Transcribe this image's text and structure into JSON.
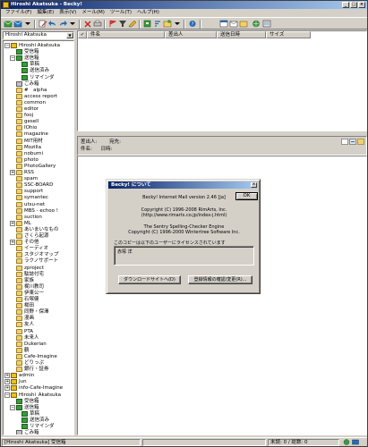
{
  "window": {
    "title": "Hiroshi Akatsuka - Becky!",
    "menu": [
      "ファイル(F)",
      "編集(E)",
      "表示(V)",
      "メール(M)",
      "ツール(T)",
      "ヘルプ(H)"
    ]
  },
  "folder_selector": {
    "value": "Hiroshi Akatsuka"
  },
  "tree": {
    "items": [
      {
        "label": "Hiroshi Akatsuka",
        "level": 0,
        "icon": "account",
        "expander": "−"
      },
      {
        "label": "受信箱",
        "level": 1,
        "icon": "mailbox",
        "expander": ""
      },
      {
        "label": "送信箱",
        "level": 1,
        "icon": "mailbox",
        "expander": "−"
      },
      {
        "label": "草稿",
        "level": 2,
        "icon": "mailbox",
        "expander": ""
      },
      {
        "label": "送信済み",
        "level": 2,
        "icon": "mailbox",
        "expander": ""
      },
      {
        "label": "リマインダ",
        "level": 2,
        "icon": "mailbox",
        "expander": ""
      },
      {
        "label": "ごみ箱",
        "level": 1,
        "icon": "trash",
        "expander": ""
      },
      {
        "label": "#　alpha",
        "level": 1,
        "icon": "folder",
        "expander": ""
      },
      {
        "label": "access report",
        "level": 1,
        "icon": "folder",
        "expander": ""
      },
      {
        "label": "common",
        "level": 1,
        "icon": "folder",
        "expander": ""
      },
      {
        "label": "editor",
        "level": 1,
        "icon": "folder",
        "expander": ""
      },
      {
        "label": "fooj",
        "level": 1,
        "icon": "folder",
        "expander": ""
      },
      {
        "label": "gesell",
        "level": 1,
        "icon": "folder",
        "expander": ""
      },
      {
        "label": "IOhio",
        "level": 1,
        "icon": "folder",
        "expander": ""
      },
      {
        "label": "magazine",
        "level": 1,
        "icon": "folder",
        "expander": ""
      },
      {
        "label": "MIT用材",
        "level": 1,
        "icon": "folder",
        "expander": ""
      },
      {
        "label": "Mozilla",
        "level": 1,
        "icon": "folder",
        "expander": ""
      },
      {
        "label": "noburni",
        "level": 1,
        "icon": "folder",
        "expander": ""
      },
      {
        "label": "photo",
        "level": 1,
        "icon": "folder",
        "expander": ""
      },
      {
        "label": "PhotoGallery",
        "level": 1,
        "icon": "folder",
        "expander": ""
      },
      {
        "label": "RSS",
        "level": 1,
        "icon": "folder",
        "expander": "+"
      },
      {
        "label": "spam",
        "level": 1,
        "icon": "folder",
        "expander": ""
      },
      {
        "label": "SSC-BOARD",
        "level": 1,
        "icon": "folder",
        "expander": ""
      },
      {
        "label": "support",
        "level": 1,
        "icon": "folder",
        "expander": ""
      },
      {
        "label": "symantec",
        "level": 1,
        "icon": "folder",
        "expander": ""
      },
      {
        "label": "utsu-net",
        "level": 1,
        "icon": "folder",
        "expander": ""
      },
      {
        "label": "MBS - echoo !",
        "level": 1,
        "icon": "folder",
        "expander": ""
      },
      {
        "label": "suction",
        "level": 1,
        "icon": "folder",
        "expander": ""
      },
      {
        "label": "ML",
        "level": 1,
        "icon": "folder",
        "expander": "+"
      },
      {
        "label": "あいまいなもの",
        "level": 1,
        "icon": "folder",
        "expander": ""
      },
      {
        "label": "さくら起源",
        "level": 1,
        "icon": "folder",
        "expander": ""
      },
      {
        "label": "その他",
        "level": 1,
        "icon": "folder",
        "expander": "+"
      },
      {
        "label": "イーディオ",
        "level": 1,
        "icon": "folder",
        "expander": ""
      },
      {
        "label": "スタジオマップ",
        "level": 1,
        "icon": "folder",
        "expander": ""
      },
      {
        "label": "ラクノサポート",
        "level": 1,
        "icon": "folder",
        "expander": ""
      },
      {
        "label": "zproject",
        "level": 1,
        "icon": "folder",
        "expander": ""
      },
      {
        "label": "駄誌付宅",
        "level": 1,
        "icon": "folder",
        "expander": ""
      },
      {
        "label": "家族",
        "level": 1,
        "icon": "folder",
        "expander": ""
      },
      {
        "label": "梶川教司",
        "level": 1,
        "icon": "folder",
        "expander": ""
      },
      {
        "label": "伊東公一",
        "level": 1,
        "icon": "folder",
        "expander": ""
      },
      {
        "label": "石塚健",
        "level": 1,
        "icon": "folder",
        "expander": ""
      },
      {
        "label": "楊田",
        "level": 1,
        "icon": "folder",
        "expander": ""
      },
      {
        "label": "同野・保澤",
        "level": 1,
        "icon": "folder",
        "expander": ""
      },
      {
        "label": "漫画",
        "level": 1,
        "icon": "folder",
        "expander": ""
      },
      {
        "label": "友人",
        "level": 1,
        "icon": "folder",
        "expander": ""
      },
      {
        "label": "PTA",
        "level": 1,
        "icon": "folder",
        "expander": ""
      },
      {
        "label": "未来人",
        "level": 1,
        "icon": "folder",
        "expander": ""
      },
      {
        "label": "Dukerian",
        "level": 1,
        "icon": "folder",
        "expander": ""
      },
      {
        "label": "鶴",
        "level": 1,
        "icon": "folder",
        "expander": ""
      },
      {
        "label": "Cafe-Imagine",
        "level": 1,
        "icon": "folder",
        "expander": ""
      },
      {
        "label": "どりっぷ",
        "level": 1,
        "icon": "folder",
        "expander": ""
      },
      {
        "label": "銀行・証券",
        "level": 1,
        "icon": "folder",
        "expander": ""
      },
      {
        "label": "admin",
        "level": 0,
        "icon": "account",
        "expander": "+"
      },
      {
        "label": "Jun",
        "level": 0,
        "icon": "account",
        "expander": "+"
      },
      {
        "label": "info-Cafe-Imagine",
        "level": 0,
        "icon": "account",
        "expander": "+"
      },
      {
        "label": "Hiroshi_Akatsuka",
        "level": 0,
        "icon": "account",
        "expander": "−"
      },
      {
        "label": "受信箱",
        "level": 1,
        "icon": "mailbox",
        "expander": ""
      },
      {
        "label": "送信箱",
        "level": 1,
        "icon": "mailbox",
        "expander": "−"
      },
      {
        "label": "草稿",
        "level": 2,
        "icon": "mailbox",
        "expander": ""
      },
      {
        "label": "送信済み",
        "level": 2,
        "icon": "mailbox",
        "expander": ""
      },
      {
        "label": "リマインダ",
        "level": 2,
        "icon": "mailbox",
        "expander": ""
      },
      {
        "label": "ごみ箱",
        "level": 1,
        "icon": "trash",
        "expander": ""
      }
    ]
  },
  "list": {
    "columns": [
      "件名",
      "差出人",
      "送信日時",
      "サイズ"
    ]
  },
  "preview_header": {
    "from_label": "差出人:",
    "to_label": "宛先:",
    "subject_label": "件名:",
    "date_label": "日時:"
  },
  "dialog": {
    "title": "Becky! について",
    "version": "Becky! Internet Mail version 2.46 [ja]",
    "copyright": "Copyright (C) 1996-2008 RimArts, Inc.",
    "url": "(http://www.rimarts.co.jp/index-j.html)",
    "engine": "The Sentry Spelling-Checker Engine",
    "engine_copyright": "Copyright (C) 1996-2000 Wintertree Software Inc.",
    "license_text": "このコピーは以下のユーザーにライセンスされています",
    "licensee": "赤塚 洋",
    "ok_label": "OK",
    "download_label": "ダウンロードサイトへ(D)",
    "register_label": "登録情報の確認/変更(R)..."
  },
  "statusbar": {
    "account": "[Hiroshi Akatsuka] 受信箱",
    "unread": "未読: 0 / 総数: 0"
  },
  "colors": {
    "title_gradient_start": "#0a246a",
    "title_gradient_end": "#a6caf0",
    "face": "#d4d0c8"
  }
}
